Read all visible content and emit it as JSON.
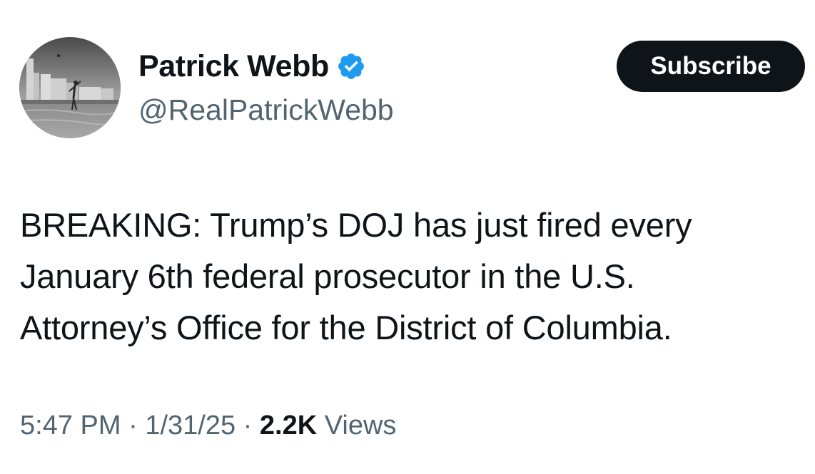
{
  "author": {
    "display_name": "Patrick Webb",
    "handle": "@RealPatrickWebb",
    "verified": true,
    "badge_color": "#1d9bf0",
    "avatar_icon": "profile-photo-beach-city"
  },
  "actions": {
    "subscribe_label": "Subscribe",
    "subscribe_bg": "#0f1419"
  },
  "tweet": {
    "lines": [
      "BREAKING: Trump’s DOJ has just fired every",
      "January 6th federal prosecutor in the U.S.",
      "Attorney’s Office for the District of Columbia."
    ]
  },
  "meta": {
    "time": "5:47 PM",
    "separator": "·",
    "date": "1/31/25",
    "views_count": "2.2K",
    "views_label": "Views",
    "muted_color": "#536471"
  }
}
